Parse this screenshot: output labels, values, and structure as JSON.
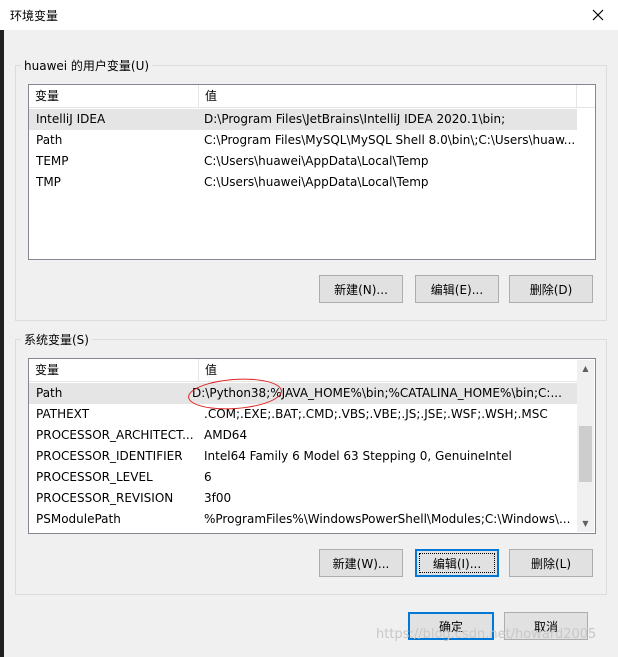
{
  "window": {
    "title": "环境变量",
    "close_icon": "close-icon"
  },
  "user_vars": {
    "group_title": "huawei 的用户变量(U)",
    "columns": [
      "变量",
      "值"
    ],
    "rows": [
      {
        "name": "IntelliJ IDEA",
        "value": "D:\\Program Files\\JetBrains\\IntelliJ IDEA 2020.1\\bin;"
      },
      {
        "name": "Path",
        "value": "C:\\Program Files\\MySQL\\MySQL Shell 8.0\\bin\\;C:\\Users\\huaw..."
      },
      {
        "name": "TEMP",
        "value": "C:\\Users\\huawei\\AppData\\Local\\Temp"
      },
      {
        "name": "TMP",
        "value": "C:\\Users\\huawei\\AppData\\Local\\Temp"
      }
    ],
    "buttons": {
      "new": "新建(N)...",
      "edit": "编辑(E)...",
      "delete": "删除(D)"
    }
  },
  "system_vars": {
    "group_title": "系统变量(S)",
    "columns": [
      "变量",
      "值"
    ],
    "rows": [
      {
        "name": "Path",
        "value": "D:\\Python38;%JAVA_HOME%\\bin;%CATALINA_HOME%\\bin;C:..."
      },
      {
        "name": "PATHEXT",
        "value": ".COM;.EXE;.BAT;.CMD;.VBS;.VBE;.JS;.JSE;.WSF;.WSH;.MSC"
      },
      {
        "name": "PROCESSOR_ARCHITECT...",
        "value": "AMD64"
      },
      {
        "name": "PROCESSOR_IDENTIFIER",
        "value": "Intel64 Family 6 Model 63 Stepping 0, GenuineIntel"
      },
      {
        "name": "PROCESSOR_LEVEL",
        "value": "6"
      },
      {
        "name": "PROCESSOR_REVISION",
        "value": "3f00"
      },
      {
        "name": "PSModulePath",
        "value": "%ProgramFiles%\\WindowsPowerShell\\Modules;C:\\Windows\\..."
      }
    ],
    "buttons": {
      "new": "新建(W)...",
      "edit": "编辑(I)...",
      "delete": "删除(L)"
    }
  },
  "footer": {
    "ok": "确定",
    "cancel": "取消"
  },
  "watermark": "https://blog.csdn.net/howard2005",
  "colors": {
    "selection": "#e5e5e5",
    "focus_border": "#0078d7",
    "annotation": "#dd2222"
  }
}
